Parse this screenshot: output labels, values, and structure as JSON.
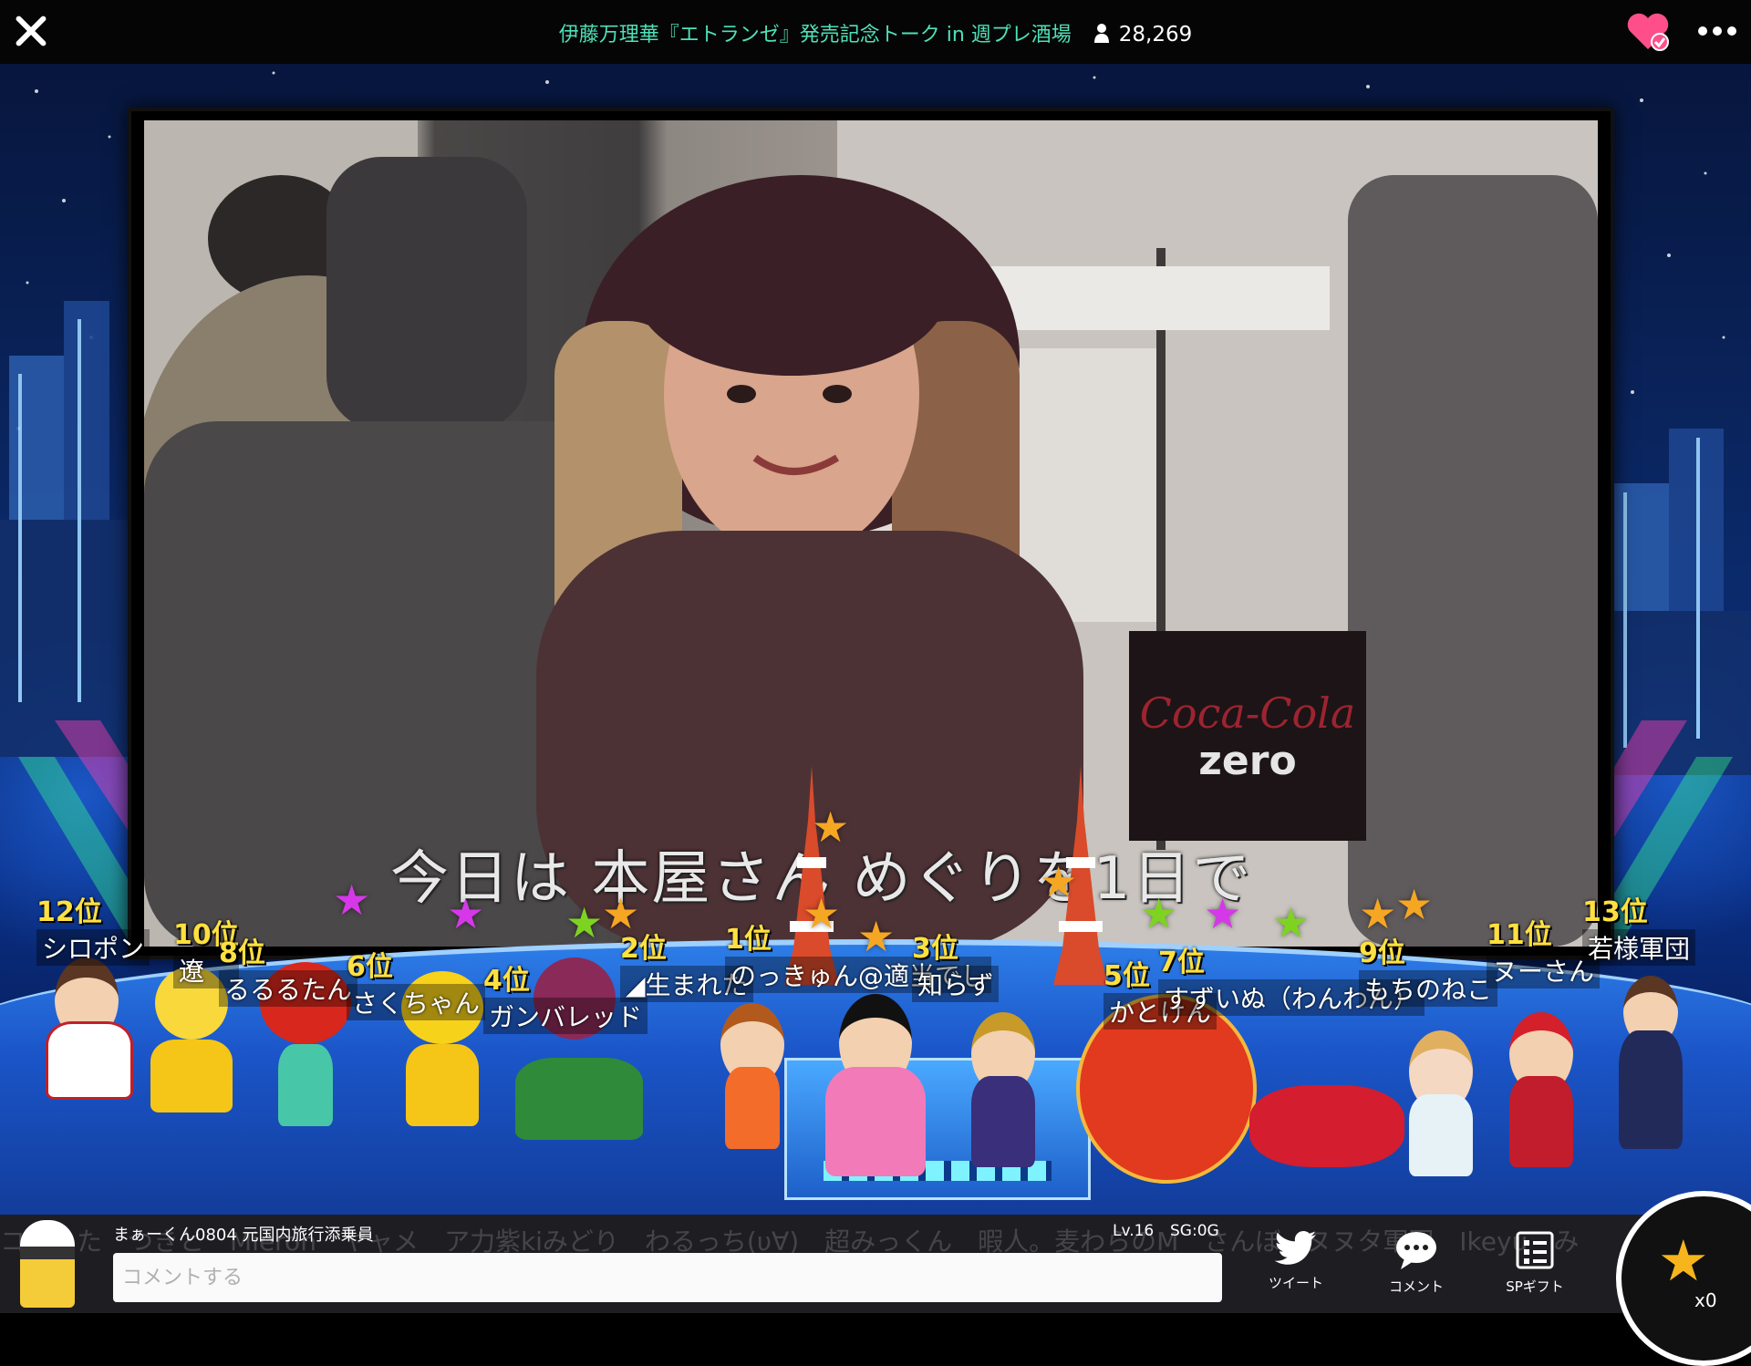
{
  "header": {
    "title": "伊藤万理華『エトランゼ』発売記念トーク in 週プレ酒場",
    "viewer_count": "28,269",
    "heart_color": "#ff4f8a"
  },
  "video": {
    "subtitle": "今日は 本屋さん めぐりを1日で",
    "sign_text_1": "Coca-Cola",
    "sign_text_2": "zero"
  },
  "ranks": [
    {
      "pos": "12位",
      "name": "シロポン"
    },
    {
      "pos": "10位",
      "name": "遼"
    },
    {
      "pos": "8位",
      "name": "るるるたん"
    },
    {
      "pos": "6位",
      "name": "さくちゃん"
    },
    {
      "pos": "4位",
      "name": "ガンバレッド"
    },
    {
      "pos": "2位",
      "name": "◢生まれた"
    },
    {
      "pos": "1位",
      "name": "のっきゅん@適当でし"
    },
    {
      "pos": "3位",
      "name": "知らず"
    },
    {
      "pos": "5位",
      "name": "かとけん"
    },
    {
      "pos": "7位",
      "name": "すずいぬ（わんわん）"
    },
    {
      "pos": "9位",
      "name": "もちのねこ"
    },
    {
      "pos": "11位",
      "name": "ヌーさん"
    },
    {
      "pos": "13位",
      "name": "若様軍団"
    }
  ],
  "footer": {
    "scroll_names": "コまりた　つきと　Mieron　ヤャメ　ア力紫kiみどり　わるっち(υ∀)　超みっくん　暇人。麦わらのM　さんぼ　ヌヌタ軍団　Ikeyu　み　のはら　バル",
    "user_name": "まぁーくん0804 元国内旅行添乗員",
    "level": "Lv.16",
    "sg": "SG:0G",
    "comment_placeholder": "コメントする",
    "tweet_label": "ツイート",
    "comment_label": "コメント",
    "sp_gift_label": "SPギフト",
    "gift_count": "x0"
  }
}
